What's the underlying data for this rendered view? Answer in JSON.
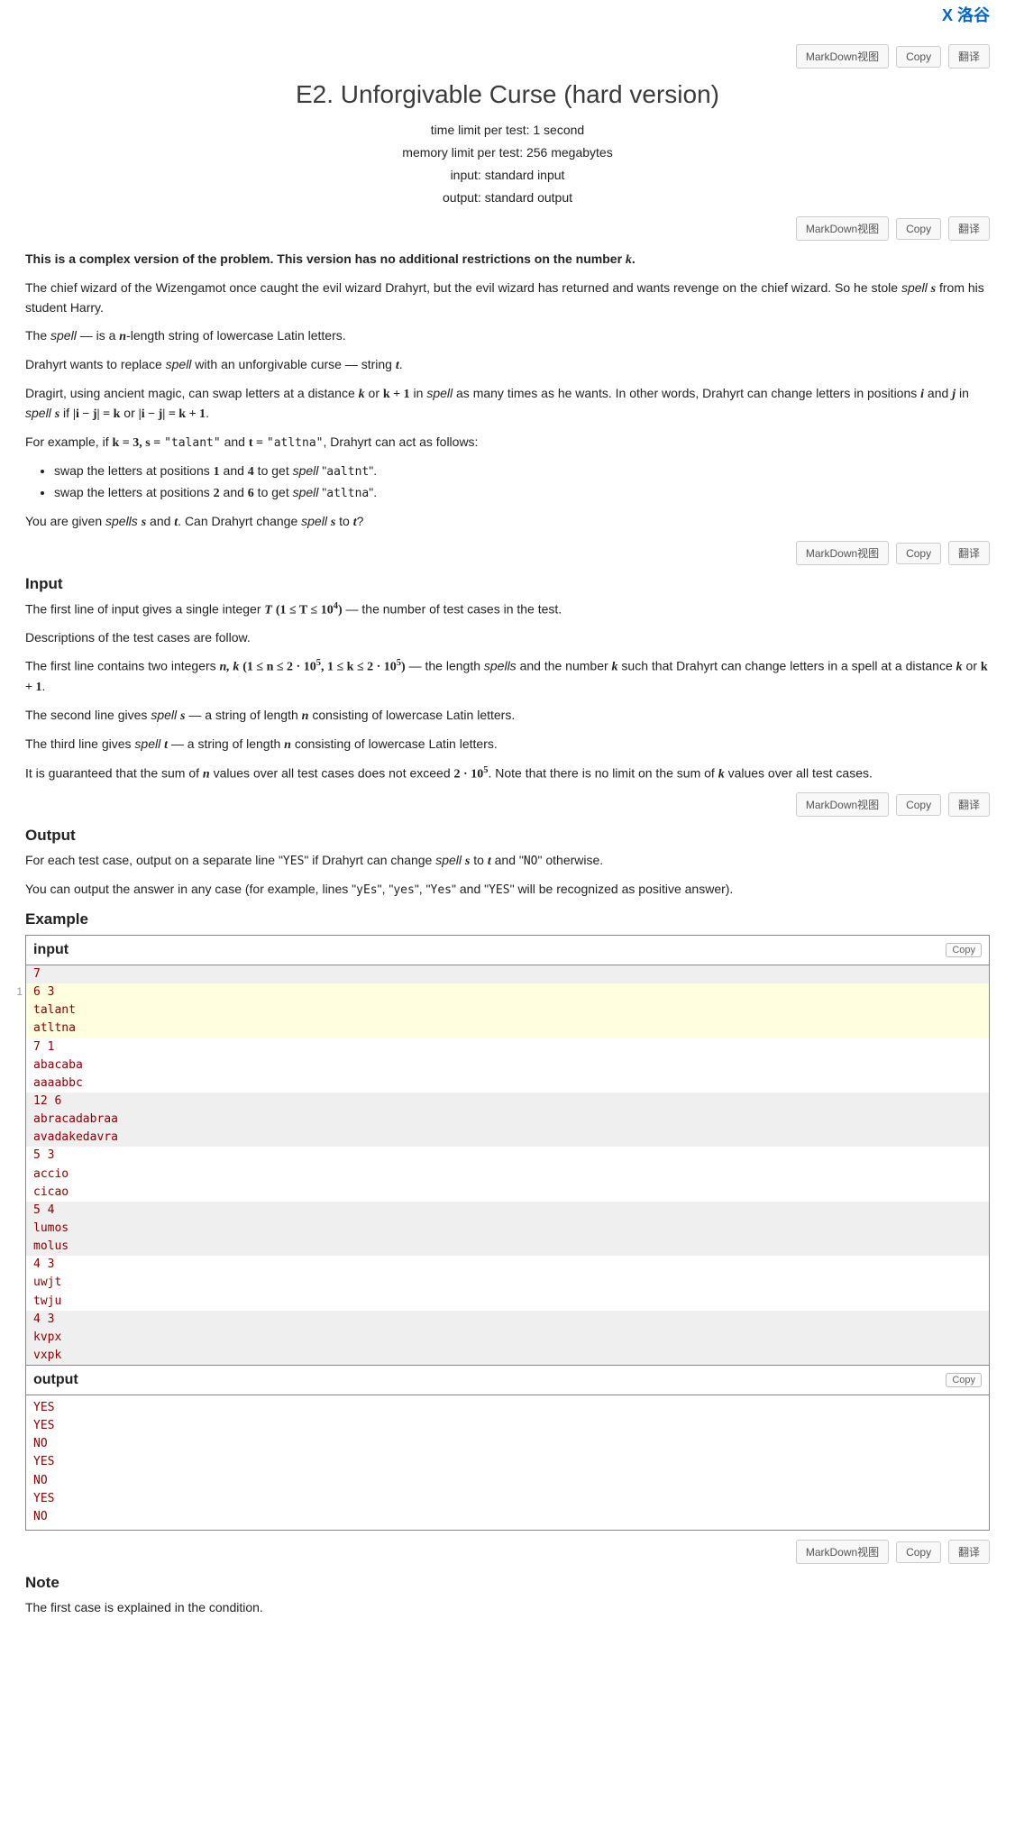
{
  "branding": "X 洛谷",
  "toolbar": {
    "markdown": "MarkDown视图",
    "copy": "Copy",
    "translate": "翻译"
  },
  "title": "E2. Unforgivable Curse (hard version)",
  "limits": {
    "time": "time limit per test: 1 second",
    "memory": "memory limit per test: 256 megabytes",
    "input": "input: standard input",
    "output": "output: standard output"
  },
  "statement": {
    "bold_intro_prefix": "This is a complex version of the problem. This version has no additional restrictions on the number ",
    "bold_intro_suffix": ".",
    "p1_a": "The chief wizard of the Wizengamot once caught the evil wizard Drahyrt, but the evil wizard has returned and wants revenge on the chief wizard. So he stole ",
    "p1_spell": "spell ",
    "p1_b": " from his student Harry.",
    "p2_a": "The ",
    "p2_spell": "spell",
    "p2_b": " — is a ",
    "p2_c": "-length string of lowercase Latin letters.",
    "p3_a": "Drahyrt wants to replace ",
    "p3_spell": "spell",
    "p3_b": " with an unforgivable curse — string ",
    "p3_c": ".",
    "p4_a": "Dragirt, using ancient magic, can swap letters at a distance ",
    "p4_or": " or ",
    "p4_in": " in ",
    "p4_spell": "spell",
    "p4_b": " as many times as he wants. In other words, Drahyrt can change letters in positions ",
    "p4_and": " and ",
    "p4_in2": " in ",
    "p4_spell2": "spell ",
    "p4_if": " if ",
    "p4_or2": " or ",
    "p4_end": ".",
    "p5_a": "For example, if ",
    "p5_and": " and ",
    "p5_b": ", Drahyrt can act as follows:",
    "li1_a": "swap the letters at positions ",
    "li1_and": " and ",
    "li1_b": " to get ",
    "li1_spell": "spell",
    "li1_c": " \"",
    "li1_code": "aaltnt",
    "li1_d": "\".",
    "li2_a": "swap the letters at positions ",
    "li2_and": " and ",
    "li2_b": " to get ",
    "li2_spell": "spell",
    "li2_c": " \"",
    "li2_code": "atltna",
    "li2_d": "\".",
    "p6_a": "You are given ",
    "p6_spells": "spells ",
    "p6_and": " and ",
    "p6_b": ". Can Drahyrt change ",
    "p6_spell": "spell ",
    "p6_to": " to ",
    "p6_c": "?"
  },
  "math": {
    "k": "k",
    "k1": "k + 1",
    "s": "s",
    "t": "t",
    "n": "n",
    "i": "i",
    "j": "j",
    "abs_ij_eq_k": "|i − j| = k",
    "abs_ij_eq_k1": "|i − j| = k + 1",
    "k_eq_3": "k = 3, s =",
    "t_eq": "t =",
    "talant": "\"talant\"",
    "atltna": "\"atltna\"",
    "one": "1",
    "two": "2",
    "four": "4",
    "six": "6",
    "T": "T",
    "T_range": "(1 ≤ T ≤ 10",
    "T_exp": "4",
    "T_range_close": ")",
    "nk": "n, k",
    "nk_range": "(1 ≤ n ≤ 2 · 10",
    "exp5": "5",
    "nk_mid": ", 1 ≤ k ≤ 2 · 10",
    "nk_close": ")",
    "two_e5": "2 · 10"
  },
  "input": {
    "title": "Input",
    "p1_a": "The first line of input gives a single integer ",
    "p1_b": " — the number of test cases in the test.",
    "p2": "Descriptions of the test cases are follow.",
    "p3_a": "The first line contains two integers ",
    "p3_b": " — the length ",
    "p3_spells": "spells",
    "p3_c": " and the number ",
    "p3_d": " such that Drahyrt can change letters in a spell at a distance ",
    "p3_or": " or ",
    "p3_e": ".",
    "p4_a": "The second line gives ",
    "p4_spell": "spell ",
    "p4_b": " — a string of length ",
    "p4_c": " consisting of lowercase Latin letters.",
    "p5_a": "The third line gives ",
    "p5_spell": "spell ",
    "p5_b": " — a string of length ",
    "p5_c": " consisting of lowercase Latin letters.",
    "p6_a": "It is guaranteed that the sum of ",
    "p6_b": " values over all test cases does not exceed ",
    "p6_c": ". Note that there is no limit on the sum of ",
    "p6_d": " values over all test cases."
  },
  "output": {
    "title": "Output",
    "p1_a": "For each test case, output on a separate line \"",
    "p1_yes": "YES",
    "p1_b": "\" if Drahyrt can change ",
    "p1_spell": "spell ",
    "p1_to": " to ",
    "p1_c": " and \"",
    "p1_no": "NO",
    "p1_d": "\" otherwise.",
    "p2_a": "You can output the answer in any case (for example, lines \"",
    "p2_yEs": "yEs",
    "p2_b": "\", \"",
    "p2_yes": "yes",
    "p2_c": "\", \"",
    "p2_Yes": "Yes",
    "p2_d": "\" and \"",
    "p2_YES": "YES",
    "p2_e": "\" will be recognized as positive answer)."
  },
  "example": {
    "title": "Example",
    "input_label": "input",
    "output_label": "output",
    "copy": "Copy",
    "line_num": "1",
    "input_groups": [
      {
        "hl": false,
        "lines": [
          "7"
        ]
      },
      {
        "hl": true,
        "lines": [
          "6 3",
          "talant",
          "atltna"
        ]
      },
      {
        "hl": false,
        "lines": [
          "7 1",
          "abacaba",
          "aaaabbc"
        ]
      },
      {
        "hl": false,
        "lines": [
          "12 6",
          "abracadabraa",
          "avadakedavra"
        ]
      },
      {
        "hl": false,
        "lines": [
          "5 3",
          "accio",
          "cicao"
        ]
      },
      {
        "hl": false,
        "lines": [
          "5 4",
          "lumos",
          "molus"
        ]
      },
      {
        "hl": false,
        "lines": [
          "4 3",
          "uwjt",
          "twju"
        ]
      },
      {
        "hl": false,
        "lines": [
          "4 3",
          "kvpx",
          "vxpk"
        ]
      }
    ],
    "output_text": "YES\nYES\nNO\nYES\nNO\nYES\nNO"
  },
  "note": {
    "title": "Note",
    "p1": "The first case is explained in the condition."
  }
}
